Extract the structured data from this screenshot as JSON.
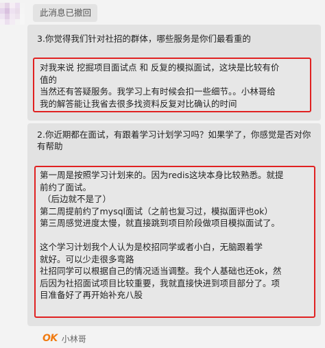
{
  "recall_notice": "此消息已撤回",
  "avatar": {
    "mosaic_colors": [
      "#f0e6ef",
      "#e4d3e6",
      "#f6eef5",
      "#ecdff0",
      "#f4f4f4",
      "#e6d6ec",
      "#d9c1df",
      "#eee2f1",
      "#e9dcea",
      "#f5f5f5",
      "#efe5f2",
      "#e2cfe6",
      "#f2e9f3",
      "#ede3ee",
      "#f6f6f6",
      "#f5f0f6",
      "#ece0ef",
      "#f3ecf4",
      "#f4f4f4",
      "#f6f6f6"
    ]
  },
  "messages": [
    {
      "question": "3.你觉得我们针对社招的群体，哪些服务是你们最看重的",
      "answer_lines": [
        "对我来说 挖掘项目面试点 和 反复的模拟面试，这块是比较有价",
        "值的",
        "当然还有答疑服务。我学习上有时候会扣一些细节。。小林哥给",
        "我的解答能让我省去很多找资料反复对比确认的时间"
      ]
    },
    {
      "question": "2.你近期都在面试，有跟着学习计划学习吗？如果学了，你感觉是否对你有帮助",
      "answer_lines": [
        "第一周是按照学习计划来的。因为redis这块本身比较熟悉。就提",
        "前约了面试。",
        " （后边就不是了）",
        "第二周提前约了mysql面试（之前也复习过，模拟面评也ok）",
        "第三周感觉进度太慢，就直接跳到项目阶段做项目模拟面试了。",
        "",
        "这个学习计划我个人认为是校招同学或者小白，无脑跟着学",
        "就好。可以少走很多弯路",
        "社招同学可以根据自己的情况适当调整。我个人基础也还ok，然",
        "后因为社招面试项目比较重要，我就直接快进到项目部分了。项",
        "目准备好了再开始补充八股"
      ]
    }
  ],
  "signature": {
    "logo_text": "OK",
    "name": "小林哥",
    "logo_color": "#f07a10"
  },
  "colors": {
    "highlight_border": "#e02020",
    "bubble_bg": "#e2e2e2",
    "page_bg": "#f3f3f3"
  }
}
